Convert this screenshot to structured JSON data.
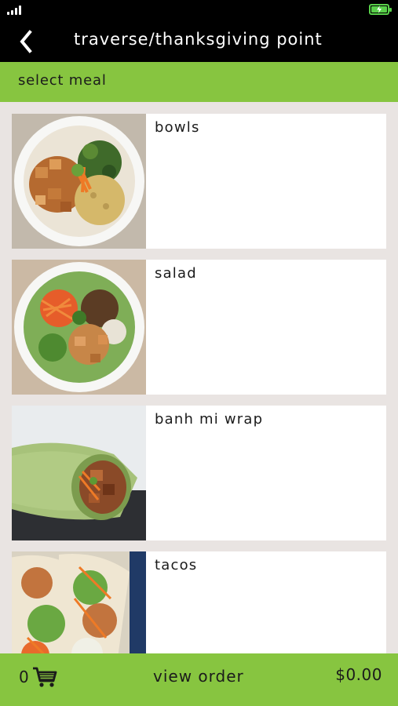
{
  "header": {
    "title": "traverse/thanksgiving point",
    "back_icon": "back-chevron-icon"
  },
  "section": {
    "title": "select meal"
  },
  "menu": {
    "items": [
      {
        "label": "bowls",
        "image": "bowl-image"
      },
      {
        "label": "salad",
        "image": "salad-image"
      },
      {
        "label": "banh mi wrap",
        "image": "wrap-image"
      },
      {
        "label": "tacos",
        "image": "tacos-image"
      }
    ]
  },
  "footer": {
    "cart_count": "0",
    "cart_icon": "cart-icon",
    "view_order_label": "view order",
    "total": "$0.00"
  },
  "colors": {
    "accent_green": "#87c540",
    "header_bg": "#000000",
    "list_bg": "#e9e4e2",
    "battery_green": "#59d04a"
  }
}
